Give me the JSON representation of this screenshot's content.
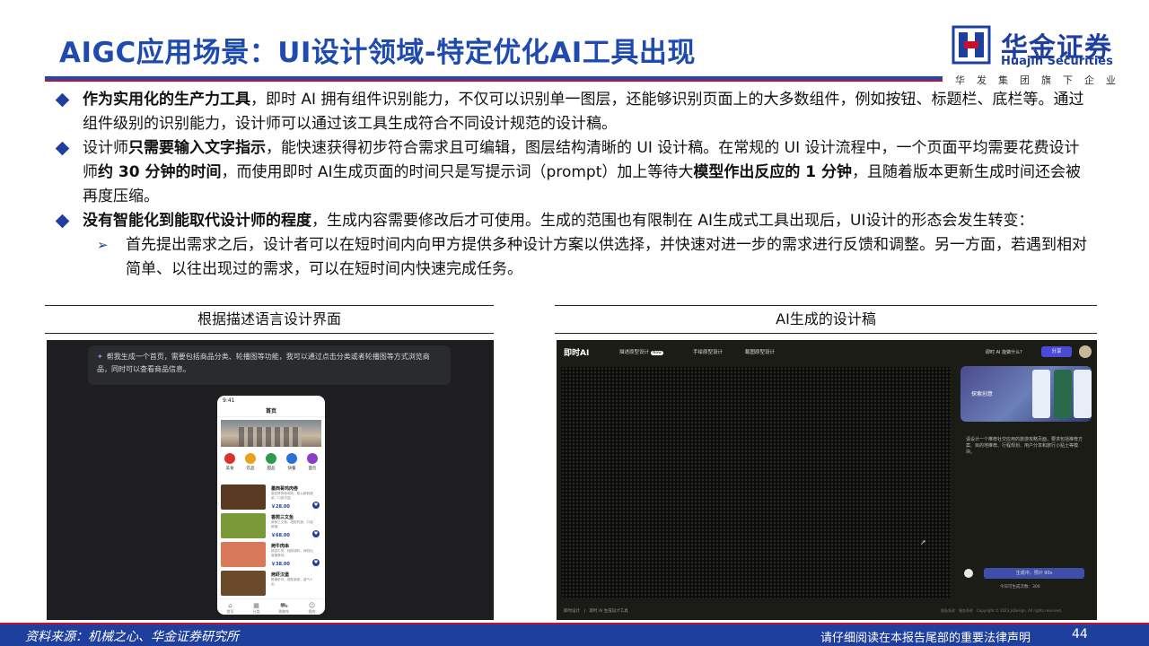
{
  "title": "AIGC应用场景：UI设计领域-特定优化AI工具出现",
  "logo": {
    "cn": "华金证券",
    "en": "Huajin Securities",
    "tagline": "华发集团旗下企业"
  },
  "bullets": [
    {
      "parts": [
        {
          "t": "作为实用化的生产力工具",
          "b": true
        },
        {
          "t": "，即时 AI 拥有组件识别能力，不仅可以识别单一图层，还能够识别页面上的大多数组件，例如按钮、标题栏、底栏等。通过组件级别的识别能力，设计师可以通过该工具生成符合不同设计规范的设计稿。",
          "b": false
        }
      ]
    },
    {
      "parts": [
        {
          "t": "设计师",
          "b": false
        },
        {
          "t": "只需要输入文字指示",
          "b": true
        },
        {
          "t": "，能快速获得初步符合需求且可编辑，图层结构清晰的 UI 设计稿。在常规的 UI 设计流程中，一个页面平均需要花费设计师",
          "b": false
        },
        {
          "t": "约 30 分钟的时间",
          "b": true
        },
        {
          "t": "，而使用即时 AI生成页面的时间只是写提示词（prompt）加上等待大",
          "b": false
        },
        {
          "t": "模型作出反应的 1 分钟",
          "b": true
        },
        {
          "t": "，且随着版本更新生成时间还会被再度压缩。",
          "b": false
        }
      ]
    },
    {
      "parts": [
        {
          "t": "没有智能化到能取代设计师的程度",
          "b": true
        },
        {
          "t": "，生成内容需要修改后才可使用。生成的范围也有限制在 AI生成式工具出现后，UI设计的形态会发生转变：",
          "b": false
        }
      ]
    }
  ],
  "sub_bullet": "首先提出需求之后，设计者可以在短时间内向甲方提供多种设计方案以供选择，并快速对进一步的需求进行反馈和调整。另一方面，若遇到相对简单、以往出现过的需求，可以在短时间内快速完成任务。",
  "panels": {
    "left_title": "根据描述语言设计界面",
    "right_title": "AI生成的设计稿"
  },
  "left_shot": {
    "prompt": "帮我生成一个首页，需要包括商品分类、轮播图等功能，我可以通过点击分类或者轮播图等方式浏览商品，同时可以查看商品信息。",
    "phone_time": "9:41",
    "phone_title": "首页",
    "categories": [
      {
        "label": "美食",
        "color": "#d9342b"
      },
      {
        "label": "饮品",
        "color": "#e8a317"
      },
      {
        "label": "甜品",
        "color": "#2e9b4a"
      },
      {
        "label": "快餐",
        "color": "#2b6fd9"
      },
      {
        "label": "面包",
        "color": "#8a3fc9"
      }
    ],
    "products": [
      {
        "name": "墨西哥鸡肉卷",
        "desc": "墨西哥风味鸡肉，配以新鲜蔬菜，口感丰富。",
        "price": "￥28.00",
        "color": "#5a3a22"
      },
      {
        "name": "香煎三文鱼",
        "desc": "新鲜三文鱼，搭配时蔬，口感鲜嫩。",
        "price": "￥68.00",
        "color": "#7a9a3a"
      },
      {
        "name": "烤牛肉串",
        "desc": "精选牛肉，秘制调料，烤制出香嫩美味。",
        "price": "￥38.00",
        "color": "#d87a5a"
      },
      {
        "name": "烤虾汉堡",
        "desc": "鲜嫩虾肉，搭配蔬菜，香气十足。",
        "price": "",
        "color": "#6a4a2a"
      }
    ],
    "tabbar": [
      "首页",
      "分类",
      "购物车",
      "我的"
    ]
  },
  "right_shot": {
    "logo": "即时AI",
    "tabs": [
      "描述原型设计",
      "手绘原型设计",
      "截图原型设计"
    ],
    "new_badge": "New",
    "ask": "即时 AI 能做什么？",
    "share": "分享",
    "card_label": "探索创意",
    "desc": "请设计一个推荐社交应用的旅游攻略页面，要求包括推荐方案、目的地推荐、行程规划、用户分享和旅行小贴士等模块。",
    "generating": "生成中，预计 90s",
    "count": "今日可生成次数：300",
    "bottom_left": "即时设计　|　即时 AI 生成设计工具",
    "bottom_right": "隐私条款　服务条款　Copyright © 2023 JsDesign. All rights reserved."
  },
  "footer": {
    "source": "资料来源：机械之心、华金证券研究所",
    "note": "请仔细阅读在本报告尾部的重要法律声明",
    "page": "44"
  }
}
